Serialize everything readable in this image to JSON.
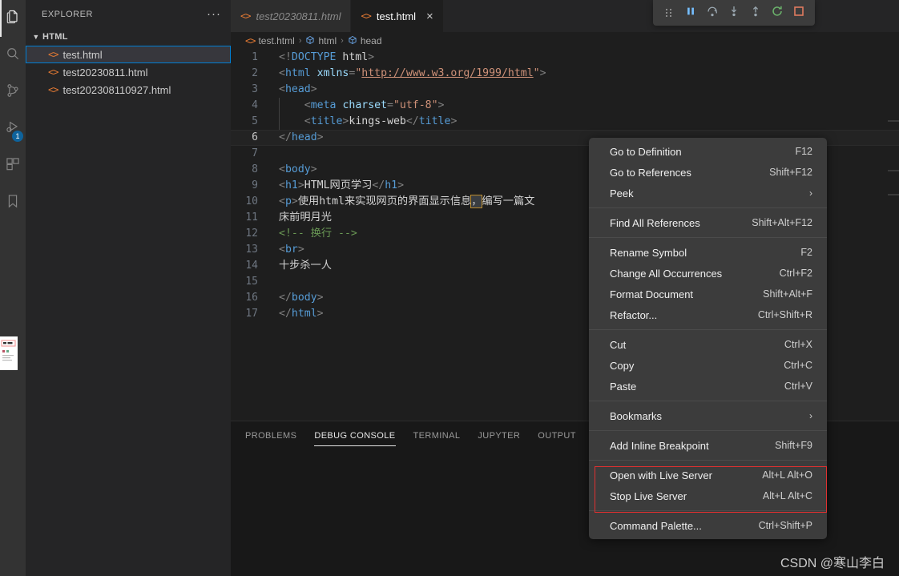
{
  "activitybar": {
    "items": [
      {
        "name": "explorer",
        "icon": "files-icon",
        "active": true,
        "badge": ""
      },
      {
        "name": "search",
        "icon": "search-icon",
        "active": false,
        "badge": ""
      },
      {
        "name": "source-control",
        "icon": "source-control-icon",
        "active": false,
        "badge": ""
      },
      {
        "name": "run-and-debug",
        "icon": "run-debug-icon",
        "active": false,
        "badge": "1"
      },
      {
        "name": "extensions",
        "icon": "extensions-icon",
        "active": false,
        "badge": ""
      },
      {
        "name": "bookmarks",
        "icon": "bookmark-icon",
        "active": false,
        "badge": ""
      }
    ]
  },
  "sidebar": {
    "title": "EXPLORER",
    "more_actions": "···",
    "section": {
      "label": "HTML",
      "expanded": true,
      "chevron": "chevron-down-icon"
    },
    "files": [
      {
        "label": "test.html",
        "icon": "html-file-icon",
        "selected": true
      },
      {
        "label": "test20230811.html",
        "icon": "html-file-icon",
        "selected": false
      },
      {
        "label": "test202308110927.html",
        "icon": "html-file-icon",
        "selected": false
      }
    ]
  },
  "tabs": [
    {
      "label": "test20230811.html",
      "icon": "html-file-icon",
      "active": false,
      "preview": true
    },
    {
      "label": "test.html",
      "icon": "html-file-icon",
      "active": true,
      "preview": false,
      "close": "×"
    }
  ],
  "debug_toolbar": {
    "buttons": [
      {
        "name": "drag-handle",
        "title": "Drag"
      },
      {
        "name": "pause-button",
        "title": "Pause"
      },
      {
        "name": "step-over-button",
        "title": "Step Over"
      },
      {
        "name": "step-into-button",
        "title": "Step Into"
      },
      {
        "name": "step-out-button",
        "title": "Step Out"
      },
      {
        "name": "restart-button",
        "title": "Restart"
      },
      {
        "name": "stop-button",
        "title": "Stop"
      }
    ],
    "colors": {
      "restart": "#6bb36b",
      "stop": "#e07b60",
      "pause": "#75beff"
    }
  },
  "breadcrumbs": [
    {
      "label": "test.html",
      "icon": "html-file-icon"
    },
    {
      "label": "html",
      "icon": "symbol-field-icon"
    },
    {
      "label": "head",
      "icon": "symbol-field-icon"
    }
  ],
  "editor": {
    "current_line": 6,
    "lines": [
      {
        "n": 1,
        "text": "<!DOCTYPE html>"
      },
      {
        "n": 2,
        "text": "<html xmlns=\"http://www.w3.org/1999/html\">"
      },
      {
        "n": 3,
        "text": "<head>"
      },
      {
        "n": 4,
        "text": "    <meta charset=\"utf-8\">"
      },
      {
        "n": 5,
        "text": "    <title>kings-web</title>"
      },
      {
        "n": 6,
        "text": "</head>"
      },
      {
        "n": 7,
        "text": ""
      },
      {
        "n": 8,
        "text": "<body>"
      },
      {
        "n": 9,
        "text": "<h1>HTML网页学习</h1>"
      },
      {
        "n": 10,
        "text": "<p>使用html来实现网页的界面显示信息，编写一篇文"
      },
      {
        "n": 11,
        "text": "床前明月光"
      },
      {
        "n": 12,
        "text": "<!-- 换行 -->"
      },
      {
        "n": 13,
        "text": "<br>"
      },
      {
        "n": 14,
        "text": "十步杀一人"
      },
      {
        "n": 15,
        "text": ""
      },
      {
        "n": 16,
        "text": "</body>"
      },
      {
        "n": 17,
        "text": "</html>"
      }
    ],
    "selection": {
      "line": 10,
      "text": "，"
    }
  },
  "panel": {
    "tabs": [
      {
        "label": "PROBLEMS",
        "active": false
      },
      {
        "label": "DEBUG CONSOLE",
        "active": true
      },
      {
        "label": "TERMINAL",
        "active": false
      },
      {
        "label": "JUPYTER",
        "active": false
      },
      {
        "label": "OUTPUT",
        "active": false
      }
    ]
  },
  "context_menu": {
    "groups": [
      [
        {
          "label": "Go to Definition",
          "key": "F12",
          "submenu": false
        },
        {
          "label": "Go to References",
          "key": "Shift+F12",
          "submenu": false
        },
        {
          "label": "Peek",
          "key": "",
          "submenu": true
        }
      ],
      [
        {
          "label": "Find All References",
          "key": "Shift+Alt+F12",
          "submenu": false
        }
      ],
      [
        {
          "label": "Rename Symbol",
          "key": "F2",
          "submenu": false
        },
        {
          "label": "Change All Occurrences",
          "key": "Ctrl+F2",
          "submenu": false
        },
        {
          "label": "Format Document",
          "key": "Shift+Alt+F",
          "submenu": false
        },
        {
          "label": "Refactor...",
          "key": "Ctrl+Shift+R",
          "submenu": false
        }
      ],
      [
        {
          "label": "Cut",
          "key": "Ctrl+X",
          "submenu": false
        },
        {
          "label": "Copy",
          "key": "Ctrl+C",
          "submenu": false
        },
        {
          "label": "Paste",
          "key": "Ctrl+V",
          "submenu": false
        }
      ],
      [
        {
          "label": "Bookmarks",
          "key": "",
          "submenu": true
        }
      ],
      [
        {
          "label": "Add Inline Breakpoint",
          "key": "Shift+F9",
          "submenu": false
        }
      ],
      [
        {
          "label": "Open with Live Server",
          "key": "Alt+L Alt+O",
          "submenu": false,
          "highlighted": true
        },
        {
          "label": "Stop Live Server",
          "key": "Alt+L Alt+C",
          "submenu": false,
          "highlighted": true
        }
      ],
      [
        {
          "label": "Command Palette...",
          "key": "Ctrl+Shift+P",
          "submenu": false
        }
      ]
    ],
    "submenu_arrow": "›",
    "annotation_color": "#e03030"
  },
  "watermark": {
    "text": "CSDN @寒山李白"
  }
}
